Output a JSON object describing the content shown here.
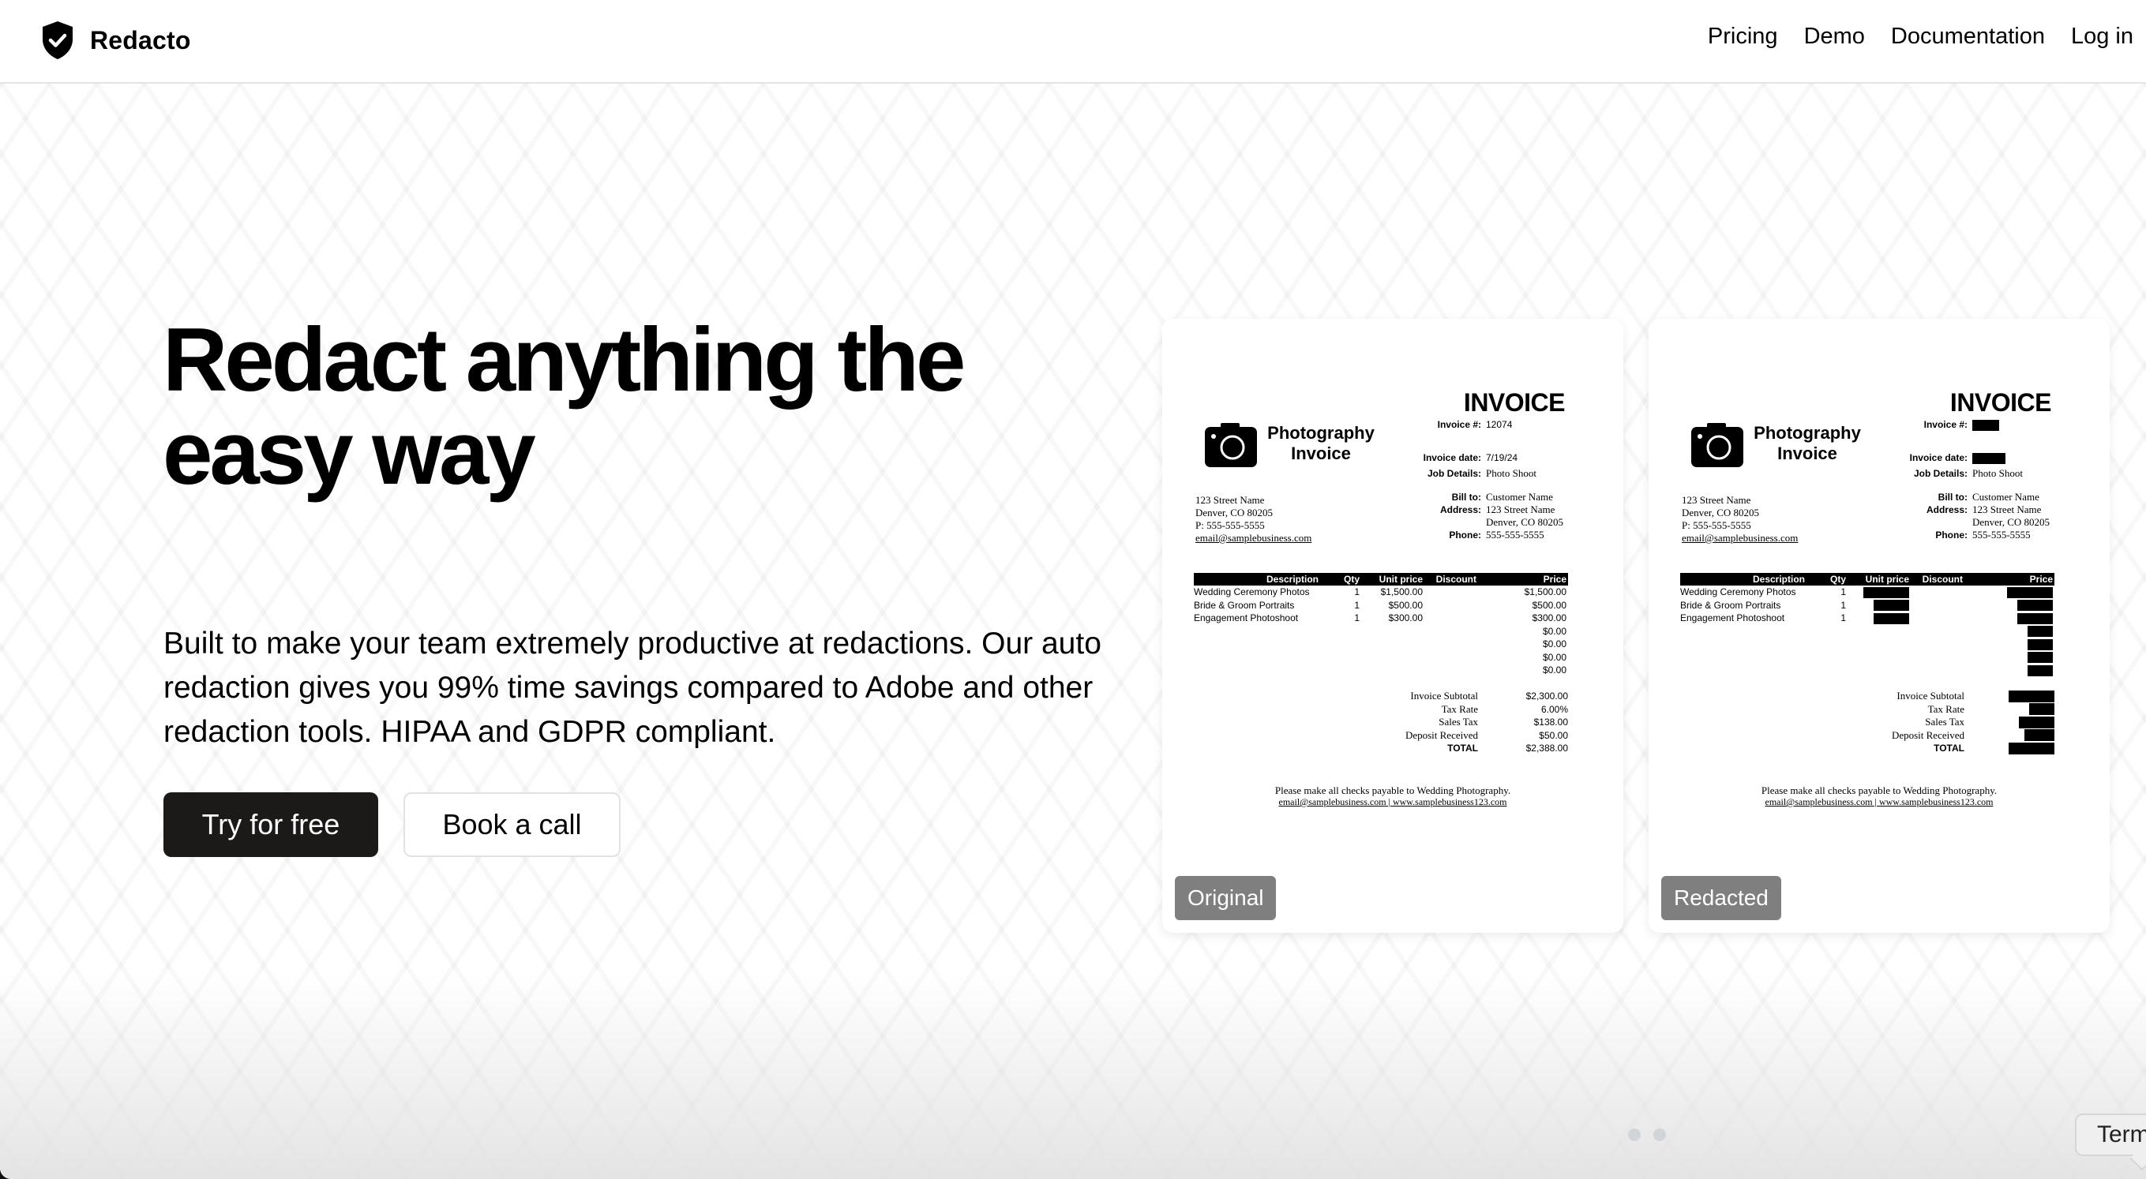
{
  "nav": {
    "brand": "Redacto",
    "logo_icon": "shield-check-icon",
    "links": [
      "Pricing",
      "Demo",
      "Documentation",
      "Log in"
    ]
  },
  "hero": {
    "headline": "Redact anything the easy way",
    "subcopy": "Built to make your team extremely productive at redactions. Our auto redaction gives you 99% time savings compared to Adobe and other redaction tools. HIPAA and GDPR compliant.",
    "primary_cta": "Try for free",
    "secondary_cta": "Book a call"
  },
  "invoice": {
    "title": "INVOICE",
    "business_name_line1": "Photography",
    "business_name_line2": "Invoice",
    "camera_icon": "camera-icon",
    "meta": {
      "invoice_no_label": "Invoice #:",
      "invoice_no": "12074",
      "date_label": "Invoice date:",
      "date": "7/19/24",
      "job_label": "Job Details:",
      "job": "Photo Shoot",
      "bill_to_label": "Bill to:",
      "bill_to": "Customer Name",
      "address_label": "Address:",
      "address_line1": "123 Street Name",
      "address_line2": "Denver, CO 80205",
      "phone_label": "Phone:",
      "phone": "555-555-5555"
    },
    "from": {
      "line1": "123 Street Name",
      "line2": "Denver, CO 80205",
      "line3": "P: 555-555-5555",
      "email": "email@samplebusiness.com"
    },
    "table": {
      "headers": [
        "Description",
        "Qty",
        "Unit price",
        "Discount",
        "Price"
      ],
      "rows": [
        [
          "Wedding Ceremony Photos",
          "1",
          "$1,500.00",
          "",
          "$1,500.00"
        ],
        [
          "Bride & Groom Portraits",
          "1",
          "$500.00",
          "",
          "$500.00"
        ],
        [
          "Engagement Photoshoot",
          "1",
          "$300.00",
          "",
          "$300.00"
        ],
        [
          "",
          "",
          "",
          "",
          "$0.00"
        ],
        [
          "",
          "",
          "",
          "",
          "$0.00"
        ],
        [
          "",
          "",
          "",
          "",
          "$0.00"
        ],
        [
          "",
          "",
          "",
          "",
          "$0.00"
        ]
      ]
    },
    "totals": [
      {
        "label": "Invoice Subtotal",
        "value": "$2,300.00"
      },
      {
        "label": "Tax Rate",
        "value": "6.00%"
      },
      {
        "label": "Sales Tax",
        "value": "$138.00"
      },
      {
        "label": "Deposit Received",
        "value": "$50.00"
      },
      {
        "label": "TOTAL",
        "value": "$2,388.00"
      }
    ],
    "footer_line1": "Please make all checks payable to Wedding Photography.",
    "footer_line2": "email@samplebusiness.com | www.samplebusiness123.com"
  },
  "cards": {
    "original_label": "Original",
    "redacted_label": "Redacted",
    "redacted_fields": [
      "invoice_no",
      "date",
      "unit_prices",
      "prices",
      "totals"
    ]
  },
  "carousel": {
    "slides": 2,
    "active": 0
  },
  "tooltip": {
    "text": "Term"
  },
  "colors": {
    "primary_button": "#1c1a19",
    "badge": "#7f7f7f",
    "dot": "#d1d4d9",
    "nav_border": "#e4e4e7"
  }
}
